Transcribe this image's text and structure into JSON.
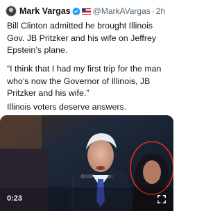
{
  "tweet": {
    "author_name": "Mark Vargas",
    "handle": "@MarkAVargas",
    "separator": "·",
    "time_ago": "2h",
    "paragraphs": [
      "Bill Clinton admitted he brought Illinois Gov. JB Pritzker and his wife on Jeffrey Epstein’s plane.",
      "“I think that I had my first trip for the man who’s now the Governor of Illinois, JB Pritzker and his wife.”",
      "Illinois voters deserve answers."
    ],
    "video": {
      "timestamp": "0:23",
      "watermark": "@GOPoversight"
    }
  },
  "colors": {
    "verified_badge": "#1d9bf0",
    "secondary_text": "#536471",
    "annotation_circle": "#e0301e"
  },
  "icons": [
    "avatar",
    "verified-badge-icon",
    "us-flag-icon",
    "expand-icon"
  ]
}
